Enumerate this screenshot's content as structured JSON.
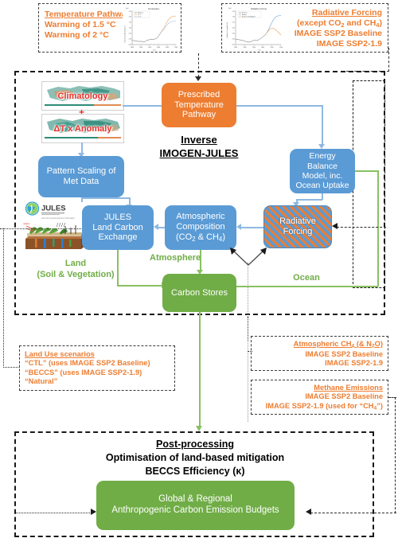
{
  "figure": {
    "kind": "model-schematic-flow-diagram",
    "colors": {
      "blue": "#5B9BD5",
      "green": "#70AD47",
      "orange": "#ED7D31",
      "annotation_text": "#ED7D31",
      "flow_label_green": "#70AD47",
      "map_label_red": "#E8302A"
    }
  },
  "top_left_note": {
    "title": "Temperature Pathway",
    "line1": "Warming of 1.5 °C",
    "line2": "Warming of 2 °C",
    "inset_chart": {
      "type": "line",
      "title": "Temperature",
      "xlabel": "Year",
      "ylabel": "Temperature Anomaly (°C)",
      "xlim": [
        1850,
        2100
      ],
      "xticks": [
        1850,
        1900,
        1950,
        2000,
        2050,
        2100
      ],
      "ylim": [
        -0.5,
        2.5
      ],
      "yticks": [
        -0.5,
        0.0,
        0.5,
        1.0,
        1.5,
        2.0,
        2.5
      ],
      "legend": [
        "Historical",
        "2.0 °C",
        "1.5 °C"
      ],
      "legend_position": "upper-left",
      "grid": false,
      "series": [
        {
          "name": "Historical",
          "color": "#555555",
          "x": [
            1850,
            1880,
            1910,
            1940,
            1960,
            1980,
            2000,
            2015
          ],
          "values": [
            -0.1,
            -0.15,
            -0.25,
            0.05,
            0.0,
            0.1,
            0.45,
            0.85
          ]
        },
        {
          "name": "2.0 °C",
          "color": "#ED9A4E",
          "x": [
            2015,
            2030,
            2050,
            2070,
            2090,
            2100
          ],
          "values": [
            0.85,
            1.2,
            1.7,
            2.0,
            2.1,
            2.12
          ]
        },
        {
          "name": "1.5 °C",
          "color": "#5B9BD5",
          "x": [
            2015,
            2030,
            2050,
            2070,
            2090,
            2100
          ],
          "values": [
            0.85,
            1.1,
            1.45,
            1.58,
            1.6,
            1.6
          ]
        }
      ]
    }
  },
  "top_right_note": {
    "title": "Radiative Forcing",
    "line1": "(except CO2 and CH4)",
    "line2": "IMAGE SSP2 Baseline",
    "line3": "IMAGE SSP2-1.9",
    "inset_chart": {
      "type": "line",
      "title": "Radiative Forcing",
      "xlabel": "Year",
      "ylabel": "Radiative Forcing (W m-2)",
      "xlim": [
        1850,
        2100
      ],
      "xticks": [
        1850,
        1900,
        1950,
        2000,
        2050,
        2100
      ],
      "ylim": [
        -0.25,
        1.25
      ],
      "yticks": [
        -0.25,
        0.0,
        0.25,
        0.5,
        0.75,
        1.0,
        1.25
      ],
      "legend": [
        "Historical",
        "Baseline",
        "Based on CO2 Mitigation"
      ],
      "legend_position": "upper-left",
      "grid": false,
      "series": [
        {
          "name": "Historical",
          "color": "#555555",
          "x": [
            1850,
            1900,
            1940,
            1970,
            2000,
            2015
          ],
          "values": [
            0.0,
            -0.05,
            -0.15,
            -0.05,
            0.15,
            0.3
          ]
        },
        {
          "name": "Baseline",
          "color": "#5B9BD5",
          "x": [
            2015,
            2035,
            2055,
            2075,
            2100
          ],
          "values": [
            0.3,
            0.7,
            1.05,
            1.12,
            1.15
          ]
        },
        {
          "name": "Based on CO2 Mitigation",
          "color": "#ED9A4E",
          "x": [
            2015,
            2035,
            2050,
            2070,
            2100
          ],
          "values": [
            0.3,
            0.62,
            0.62,
            0.45,
            0.35
          ]
        }
      ]
    }
  },
  "inverse_model": {
    "title_line1": "Inverse",
    "title_line2": "IMOGEN-JULES",
    "maps": {
      "climatology_label": "Climatology",
      "plus_symbol": "+",
      "anomaly_label": "ΔT x Anomaly"
    },
    "boxes": {
      "prescribed": "Prescribed Temperature Pathway",
      "prescribed_lines": [
        "Prescribed",
        "Temperature",
        "Pathway"
      ],
      "pattern_scaling": [
        "Pattern Scaling of",
        "Met Data"
      ],
      "energy_balance": [
        "Energy Balance",
        "Model, inc.",
        "Ocean Uptake"
      ],
      "jules": [
        "JULES",
        "Land Carbon",
        "Exchange"
      ],
      "atmos_comp_l1": "Atmospheric",
      "atmos_comp_l2": "Composition",
      "atmos_comp_l3_pre": "(CO",
      "atmos_comp_l3_sub1": "2",
      "atmos_comp_l3_mid": " & CH",
      "atmos_comp_l3_sub2": "4",
      "atmos_comp_l3_post": ")",
      "radiative_forcing": [
        "Radiative",
        "Forcing"
      ],
      "carbon_stores": "Carbon Stores"
    },
    "flow_labels": {
      "land_l1": "Land",
      "land_l2": "(Soil & Vegetation)",
      "atmosphere": "Atmosphere",
      "ocean": "Ocean"
    },
    "jules_logo": {
      "wordmark": "JULES",
      "strapline": "Joint UK Land Environment Simulator"
    }
  },
  "land_use_note": {
    "title": "Land Use scenarios",
    "line1": "“CTL”  (uses IMAGE SSP2 Baseline)",
    "line2": "“BECCS” (uses IMAGE SSP2-1.9)",
    "line3": "“Natural”"
  },
  "ch4_note": {
    "title_pre": "Atmospheric CH",
    "title_sub": "4",
    "title_post": " (& N",
    "title_sub2": "2",
    "title_post2": "O)",
    "title_plain": "Atmospheric CH4 (& N2O)",
    "line1": "IMAGE SSP2 Baseline",
    "line2": "IMAGE SSP2-1.9"
  },
  "methane_note": {
    "title": "Methane Emissions",
    "line1": "IMAGE SSP2 Baseline",
    "line2_pre": "IMAGE SSP2-1.9 (used for “CH",
    "line2_sub": "4",
    "line2_post": "”)",
    "line2_plain": "IMAGE SSP2-1.9 (used for “CH4”)"
  },
  "post_processing": {
    "title": "Post-processing",
    "line1": "Optimisation of land-based mitigation",
    "line2": "BECCS Efficiency (κ)",
    "output_box_l1": "Global & Regional",
    "output_box_l2": "Anthropogenic Carbon Emission Budgets"
  }
}
